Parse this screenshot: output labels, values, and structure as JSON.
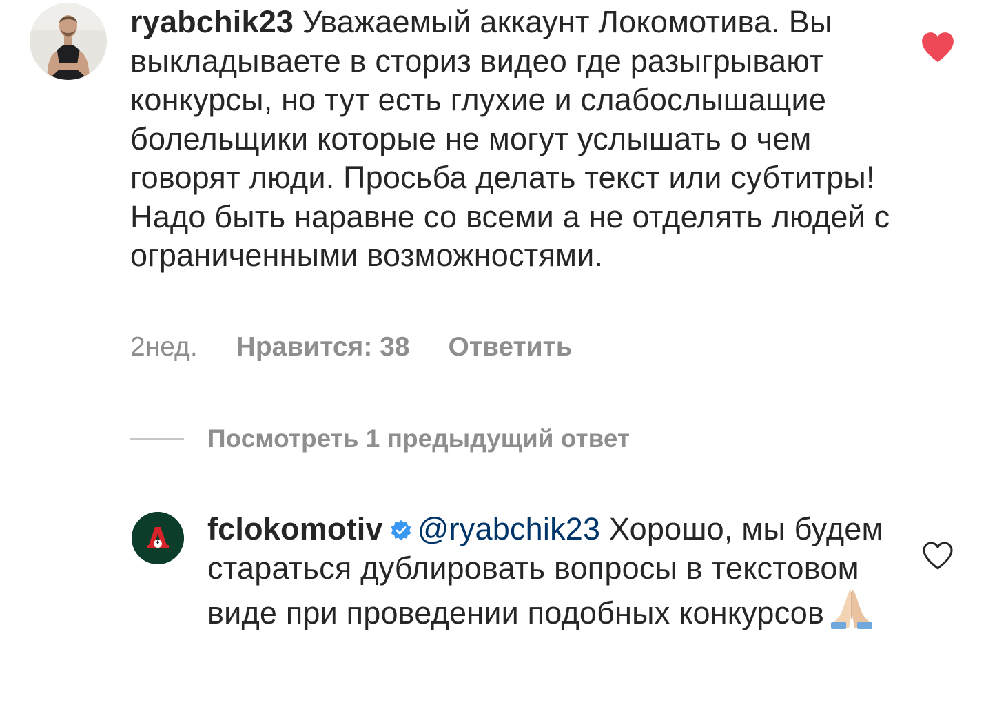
{
  "comment": {
    "username": "ryabchik23",
    "text": "Уважаемый аккаунт Локомотива. Вы выкладываете в сториз видео где разыгрывают конкурсы, но тут есть глухие и слабослышащие болельщики которые не могут услышать о чем говорят люди. Просьба делать текст или субтитры! Надо быть наравне со всеми а не отделять людей с ограниченными возможностями.",
    "time": "2нед.",
    "likes_label": "Нравится: 38",
    "reply_label": "Ответить",
    "liked": true
  },
  "view_replies_label": "Посмотреть 1 предыдущий ответ",
  "reply": {
    "username": "fclokomotiv",
    "verified": true,
    "mention": "@ryabchik23",
    "text": "Хорошо, мы будем стараться дублировать вопросы в текстовом виде при проведении подобных конкурсов",
    "emoji": "folded-hands",
    "liked": false
  },
  "colors": {
    "text": "#262626",
    "secondary": "#8e8e8e",
    "mention": "#003569",
    "like_red": "#ed4956",
    "verified_blue": "#3897f0",
    "club_green": "#0c3d2b",
    "club_red": "#d8232a"
  }
}
